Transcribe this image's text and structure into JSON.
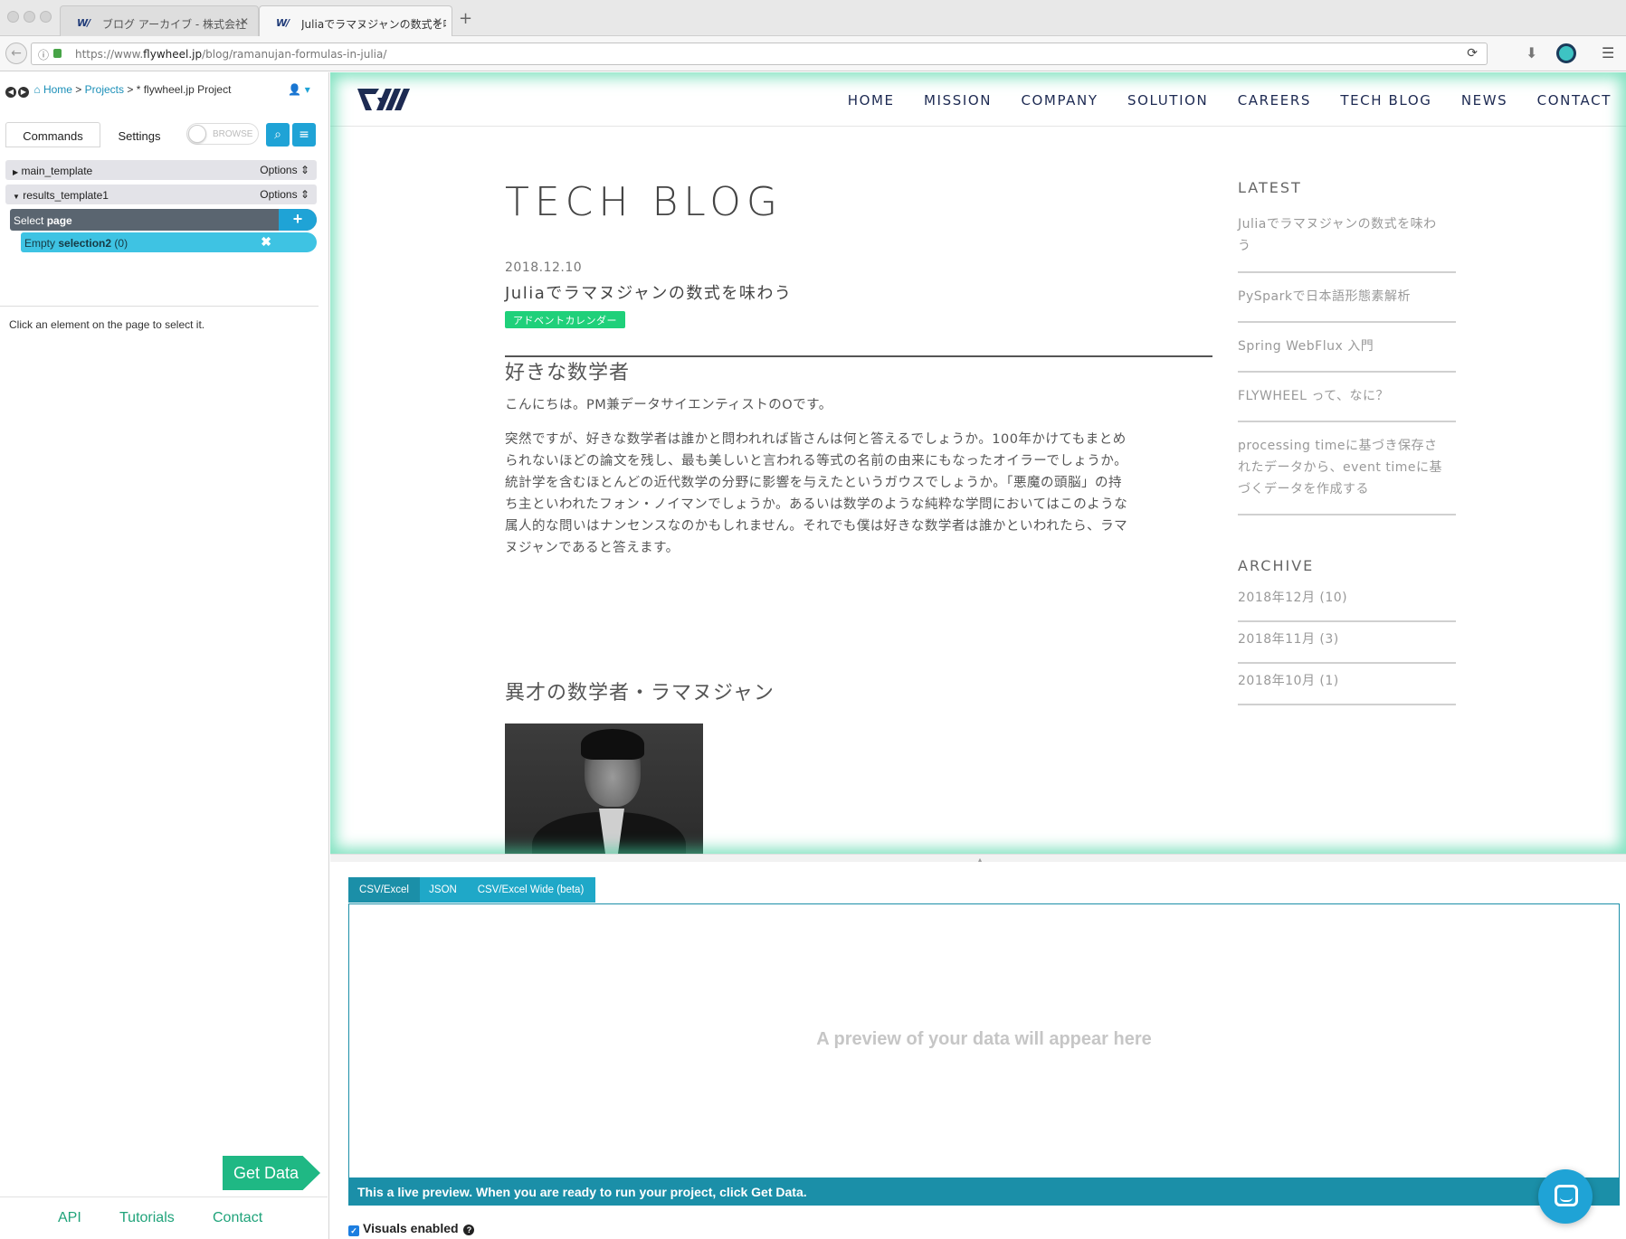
{
  "browser": {
    "tabs": [
      {
        "label": "ブログ アーカイブ - 株式会社フ",
        "favicon": "flywheel-favicon"
      },
      {
        "label": "Juliaでラマヌジャンの数式を味",
        "favicon": "flywheel-favicon"
      }
    ],
    "url_prefix": "https://www.",
    "url_domain": "flywheel.jp",
    "url_path": "/blog/ramanujan-formulas-in-julia/"
  },
  "parsehub": {
    "breadcrumb": {
      "home": "Home",
      "sep1": ">",
      "projects": "Projects",
      "sep2": ">",
      "project": "* flywheel.jp Project"
    },
    "tabs": {
      "commands": "Commands",
      "settings": "Settings"
    },
    "browse_label": "BROWSE",
    "templates": [
      {
        "name": "main_template",
        "options": "Options"
      },
      {
        "name": "results_template1",
        "options": "Options"
      }
    ],
    "select_row": {
      "prefix": "Select",
      "target": "page"
    },
    "empty_row": {
      "prefix": "Empty",
      "target": "selection2",
      "count": "(0)"
    },
    "hint": "Click an element on the page to select it.",
    "get_data": "Get Data",
    "footer": {
      "api": "API",
      "tutorials": "Tutorials",
      "contact": "Contact"
    }
  },
  "site": {
    "nav": [
      "HOME",
      "MISSION",
      "COMPANY",
      "SOLUTION",
      "CAREERS",
      "TECH BLOG",
      "NEWS",
      "CONTACT"
    ],
    "blog_title": "TECH BLOG",
    "post": {
      "date": "2018.12.10",
      "title": "Juliaでラマヌジャンの数式を味わう",
      "tag": "アドベントカレンダー",
      "h2_1": "好きな数学者",
      "p1": "こんにちは。PM兼データサイエンティストのOです。",
      "p2_lines": [
        "突然ですが、好きな数学者は誰かと問われれば皆さんは何と答えるでしょうか。100年かけてもまとめ",
        "られないほどの論文を残し、最も美しいと言われる等式の名前の由来にもなったオイラーでしょうか。",
        "統計学を含むほとんどの近代数学の分野に影響を与えたというガウスでしょうか。「悪魔の頭脳」の持",
        "ち主といわれたフォン・ノイマンでしょうか。あるいは数学のような純粋な学問においてはこのような",
        "属人的な問いはナンセンスなのかもしれません。それでも僕は好きな数学者は誰かといわれたら、ラマ",
        "ヌジャンであると答えます。"
      ],
      "h2_2": "異才の数学者・ラマヌジャン"
    },
    "sidebar": {
      "latest_heading": "LATEST",
      "latest": [
        [
          "Juliaでラマヌジャンの数式を味わ",
          "う"
        ],
        [
          "PySparkで日本語形態素解析"
        ],
        [
          "Spring WebFlux 入門"
        ],
        [
          "FLYWHEEL って、なに？"
        ],
        [
          "processing timeに基づき保存さ",
          "れたデータから、event timeに基",
          "づくデータを作成する"
        ]
      ],
      "archive_heading": "ARCHIVE",
      "archive": [
        "2018年12月 (10)",
        "2018年11月 (3)",
        "2018年10月 (1)"
      ]
    }
  },
  "preview": {
    "tabs": [
      "CSV/Excel",
      "JSON",
      "CSV/Excel Wide (beta)"
    ],
    "placeholder": "A preview of your data will appear here",
    "bar_text": "This a live preview. When you are ready to run your project, click Get Data.",
    "visuals_label": "Visuals enabled"
  },
  "colors": {
    "accent_blue": "#1fa3d6",
    "accent_green": "#1fb884",
    "preview_teal": "#1b8fa8",
    "nav_navy": "#1d2a52",
    "tag_green": "#1fd07a"
  }
}
